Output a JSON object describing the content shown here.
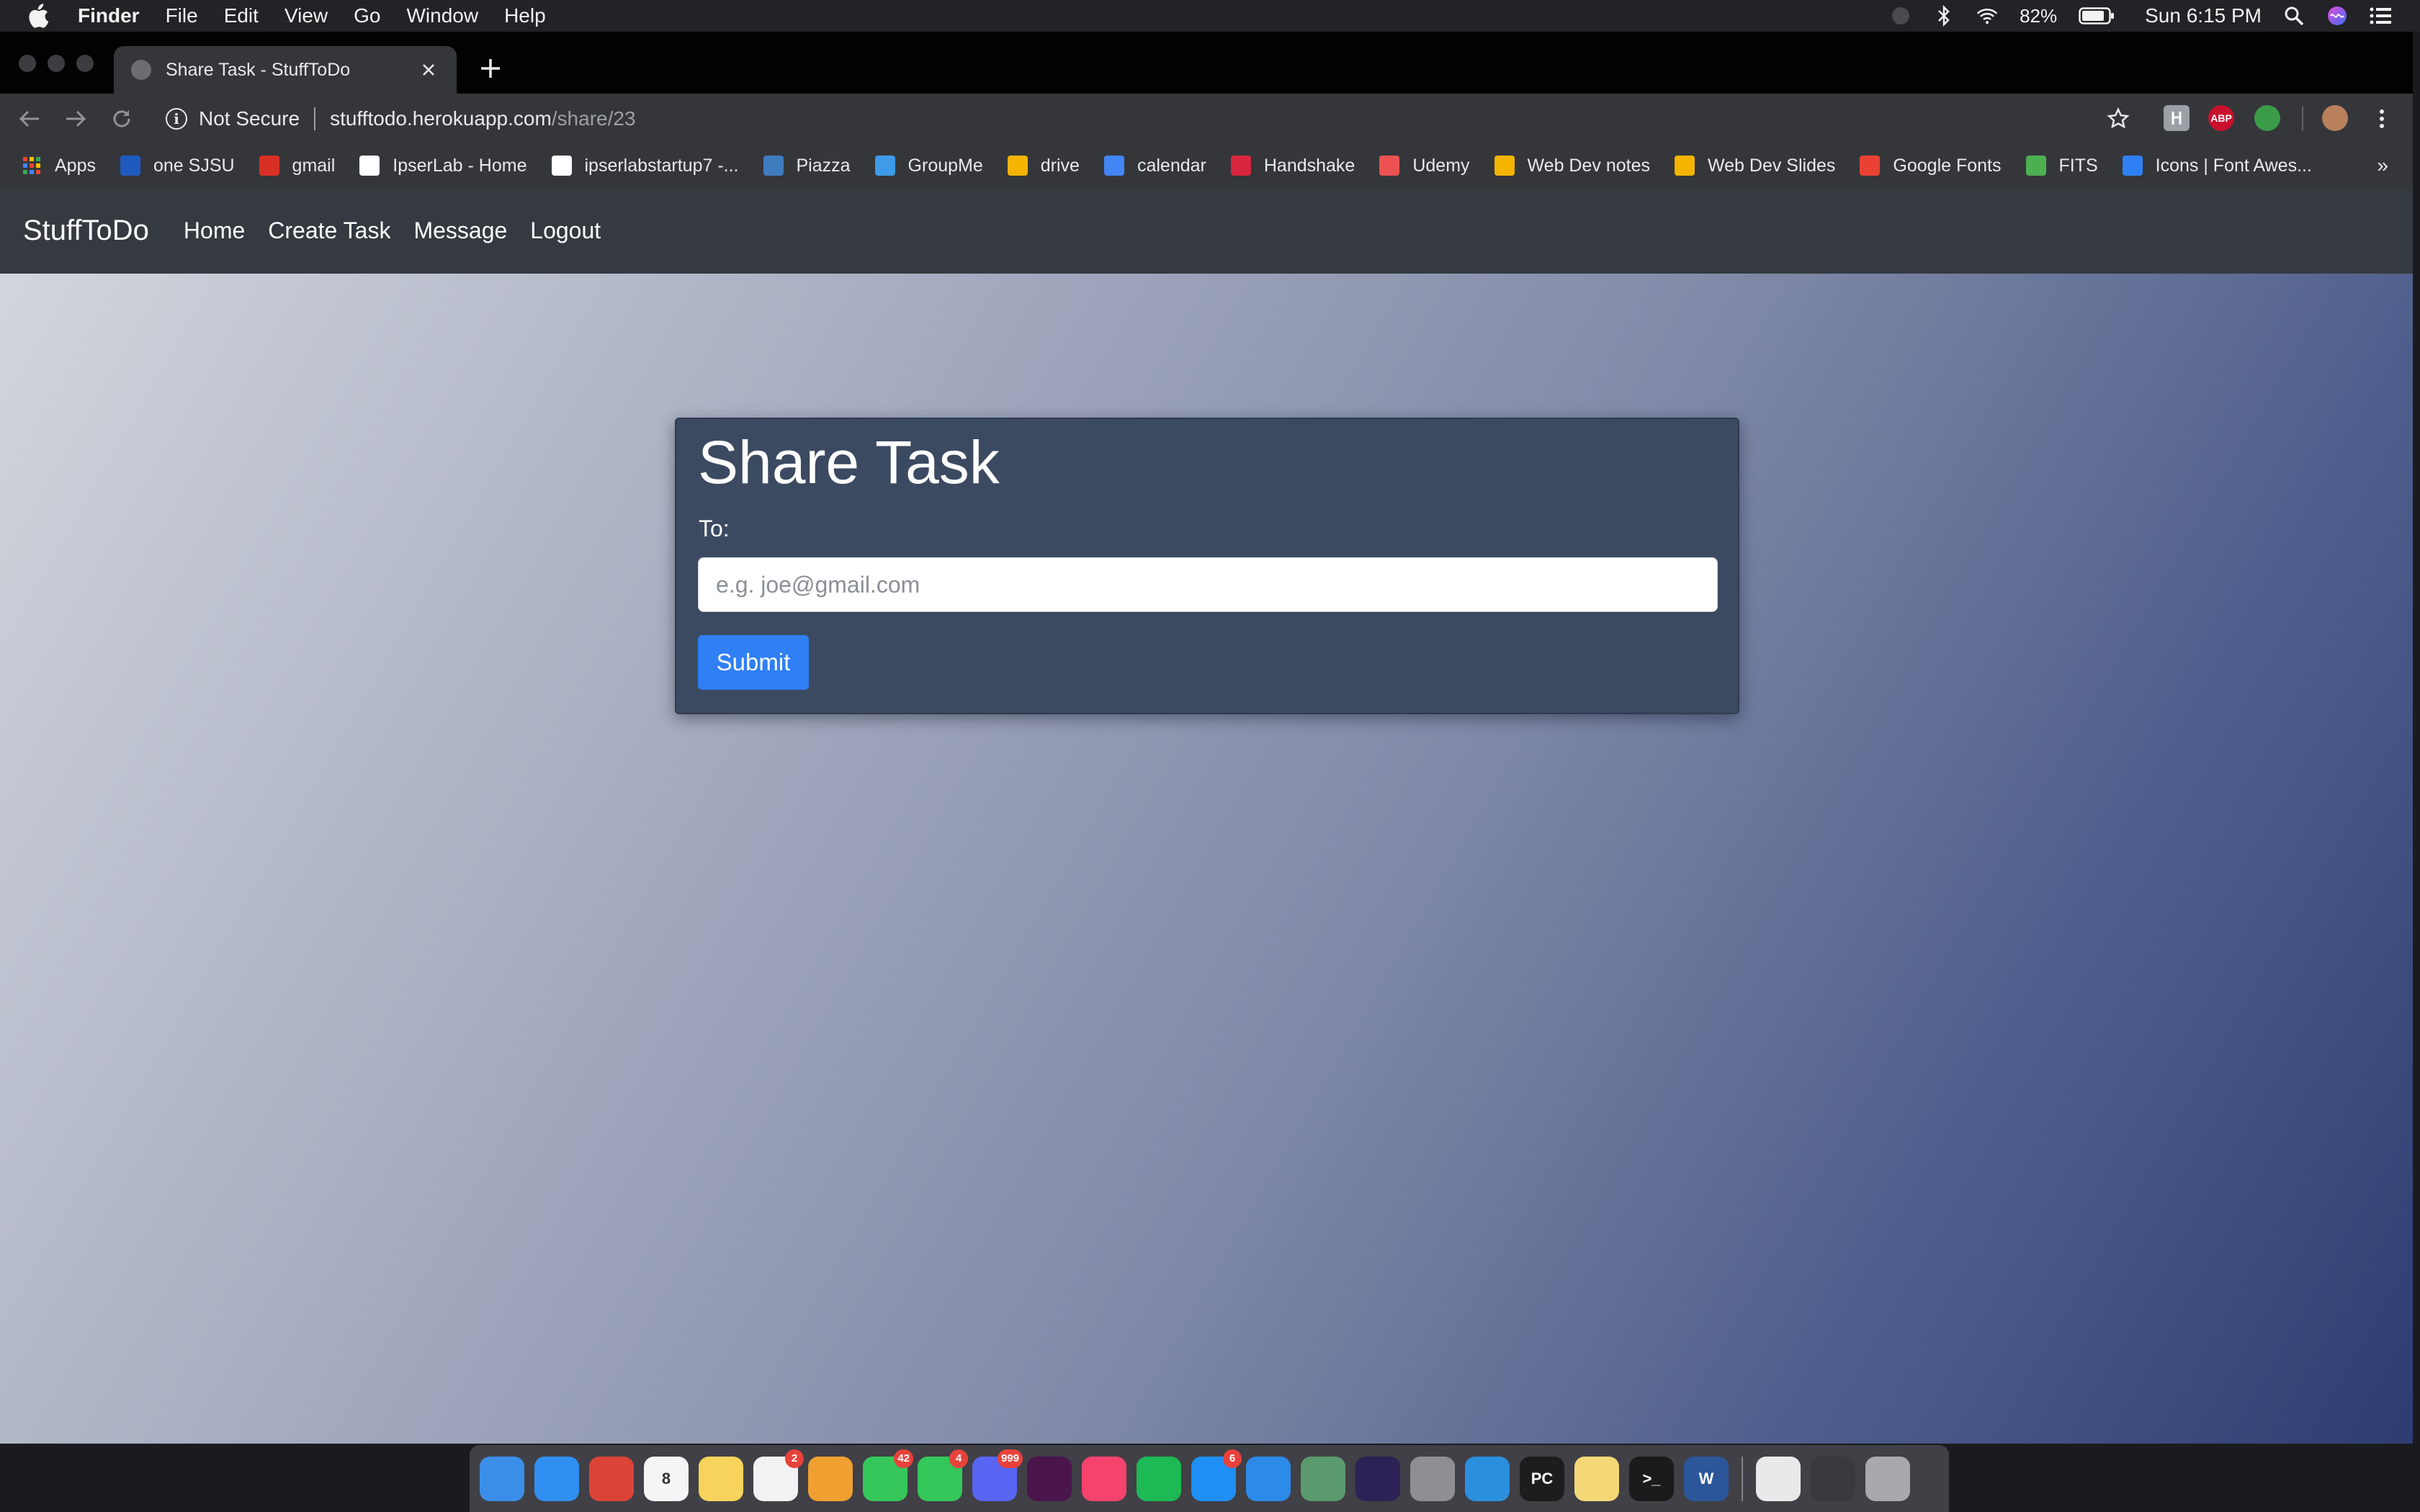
{
  "menubar": {
    "app_name": "Finder",
    "items": [
      "File",
      "Edit",
      "View",
      "Go",
      "Window",
      "Help"
    ],
    "battery": "82%",
    "clock": "Sun 6:15 PM",
    "icons": [
      "apple-icon",
      "siri-bubble-icon",
      "bluetooth-icon",
      "wifi-icon",
      "battery-icon",
      "spotlight-icon",
      "siri-icon",
      "notification-center-icon"
    ]
  },
  "browser": {
    "tab_title": "Share Task - StuffToDo",
    "security_label": "Not Secure",
    "url_host": "stufftodo.herokuapp.com",
    "url_path": "/share/23",
    "bookmarks": [
      {
        "label": "Apps",
        "icon": "apps-grid-icon",
        "color": "#e94235"
      },
      {
        "label": "one SJSU",
        "icon": "sjsu-icon",
        "color": "#1f5bbf"
      },
      {
        "label": "gmail",
        "icon": "gmail-icon",
        "color": "#d93025"
      },
      {
        "label": "IpserLab - Home",
        "icon": "page-icon",
        "color": "#ffffff"
      },
      {
        "label": "ipserlabstartup7 -...",
        "icon": "page-icon",
        "color": "#ffffff"
      },
      {
        "label": "Piazza",
        "icon": "piazza-icon",
        "color": "#3e7bbf"
      },
      {
        "label": "GroupMe",
        "icon": "groupme-icon",
        "color": "#3d9be9"
      },
      {
        "label": "drive",
        "icon": "google-drive-icon",
        "color": "#f4b400"
      },
      {
        "label": "calendar",
        "icon": "calendar-icon",
        "color": "#4285f4"
      },
      {
        "label": "Handshake",
        "icon": "handshake-icon",
        "color": "#d7263d"
      },
      {
        "label": "Udemy",
        "icon": "udemy-icon",
        "color": "#ec5252"
      },
      {
        "label": "Web Dev notes",
        "icon": "google-drive-icon",
        "color": "#f4b400"
      },
      {
        "label": "Web Dev Slides",
        "icon": "google-drive-icon",
        "color": "#f4b400"
      },
      {
        "label": "Google Fonts",
        "icon": "google-fonts-icon",
        "color": "#e94235"
      },
      {
        "label": "FITS",
        "icon": "fits-icon",
        "color": "#4caf50"
      },
      {
        "label": "Icons | Font Awes...",
        "icon": "font-awesome-icon",
        "color": "#2f7ff5"
      }
    ]
  },
  "site": {
    "brand": "StuffToDo",
    "nav": [
      "Home",
      "Create Task",
      "Message",
      "Logout"
    ]
  },
  "form": {
    "title": "Share Task",
    "to_label": "To:",
    "email_placeholder": "e.g. joe@gmail.com",
    "email_value": "",
    "submit_label": "Submit"
  },
  "dock": {
    "apps": [
      {
        "name": "finder-icon",
        "color": "#3b8ee8",
        "badge": ""
      },
      {
        "name": "safari-icon",
        "color": "#2f8ff0",
        "badge": ""
      },
      {
        "name": "chrome-icon",
        "color": "#db4437",
        "badge": ""
      },
      {
        "name": "calendar-app-icon",
        "color": "#f5f5f5",
        "badge": "",
        "text": "8"
      },
      {
        "name": "notes-icon",
        "color": "#f7d35c",
        "badge": ""
      },
      {
        "name": "reminders-icon",
        "color": "#f2f2f2",
        "badge": "2"
      },
      {
        "name": "photos-icon",
        "color": "#f0a030",
        "badge": ""
      },
      {
        "name": "messages-icon",
        "color": "#35c759",
        "badge": "42"
      },
      {
        "name": "facetime-icon",
        "color": "#34c759",
        "badge": "4"
      },
      {
        "name": "discord-icon",
        "color": "#5865f2",
        "badge": "999"
      },
      {
        "name": "slack-icon",
        "color": "#4a154b",
        "badge": ""
      },
      {
        "name": "itunes-icon",
        "color": "#f5436e",
        "badge": ""
      },
      {
        "name": "spotify-icon",
        "color": "#1db954",
        "badge": ""
      },
      {
        "name": "app-store-icon",
        "color": "#1f8ff5",
        "badge": "6"
      },
      {
        "name": "xcode-icon",
        "color": "#2c8ae8",
        "badge": ""
      },
      {
        "name": "atom-icon",
        "color": "#5a9a6e",
        "badge": ""
      },
      {
        "name": "eclipse-icon",
        "color": "#2c2255",
        "badge": ""
      },
      {
        "name": "system-preferences-icon",
        "color": "#8e8e93",
        "badge": ""
      },
      {
        "name": "vscode-icon",
        "color": "#2b8fe0",
        "badge": ""
      },
      {
        "name": "pycharm-icon",
        "color": "#1d1d1d",
        "badge": "",
        "text": "PC"
      },
      {
        "name": "stickies-icon",
        "color": "#f4d776",
        "badge": ""
      },
      {
        "name": "terminal-icon",
        "color": "#1b1b1b",
        "badge": "",
        "text": ">_"
      },
      {
        "name": "word-icon",
        "color": "#2b579a",
        "badge": "",
        "text": "W"
      }
    ],
    "stack_icons": [
      {
        "name": "documents-stack-icon",
        "color": "#e9e9ea"
      },
      {
        "name": "screenshots-stack-icon",
        "color": "#3a3a3e"
      },
      {
        "name": "trash-icon",
        "color": "#a8a8ad"
      }
    ]
  }
}
